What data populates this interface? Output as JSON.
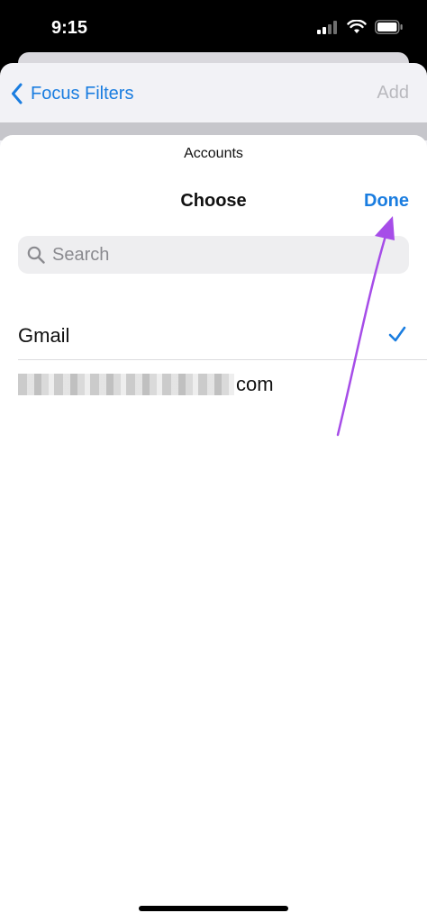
{
  "status_bar": {
    "time": "9:15"
  },
  "back_nav": {
    "back_label": "Focus Filters",
    "add_label": "Add"
  },
  "sheet": {
    "accounts_label": "Accounts",
    "title": "Choose",
    "done_label": "Done",
    "search": {
      "placeholder": "Search"
    },
    "items": [
      {
        "label": "Gmail",
        "selected": true
      },
      {
        "label": "com",
        "redacted_prefix": true,
        "selected": false
      }
    ]
  },
  "colors": {
    "accent": "#1a7de0",
    "annotation": "#a64de8"
  },
  "icons": [
    "signal-icon",
    "wifi-icon",
    "battery-icon",
    "chevron-left-icon",
    "search-icon",
    "checkmark-icon"
  ]
}
